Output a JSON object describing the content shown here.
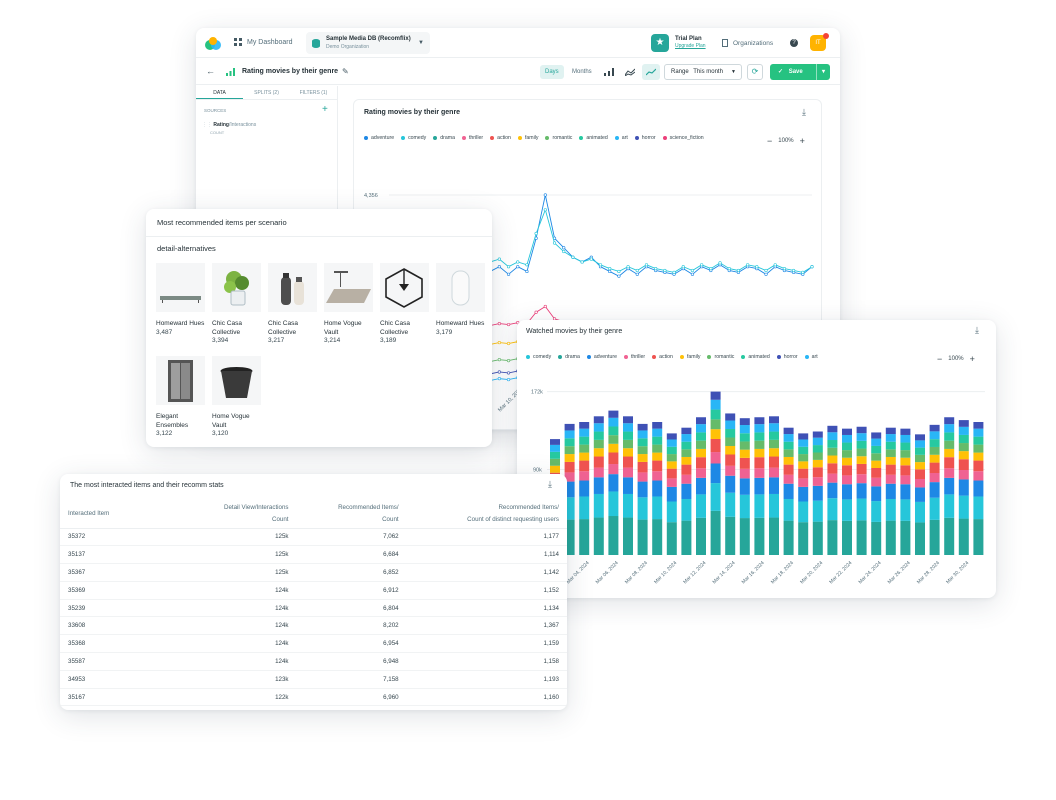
{
  "colors": {
    "adventure": "#1e88e5",
    "comedy": "#26c6da",
    "drama": "#26a69a",
    "thriller": "#f06292",
    "action": "#ef5350",
    "family": "#ffc107",
    "romantic": "#66bb6a",
    "animated": "#26c9a0",
    "art": "#29b6f6",
    "horror": "#3f51b5",
    "science_fiction": "#ec407a",
    "accent": "#26a69a"
  },
  "app": {
    "nav": {
      "dashboard": "My Dashboard"
    },
    "db": {
      "name": "Sample Media DB (Recomflix)",
      "org": "Demo Organization"
    },
    "plan": {
      "name": "Trial Plan",
      "upgrade": "Upgrade Plan"
    },
    "organizations": "Organizations",
    "help": "?",
    "avatar": "IT",
    "page_title": "Rating movies by their genre",
    "toggle": {
      "days": "Days",
      "months": "Months"
    },
    "range": {
      "label": "Range",
      "value": "This month"
    },
    "save": "Save",
    "side": {
      "tabs": [
        "DATA",
        "SPLITS (2)",
        "FILTERS (1)"
      ],
      "sources_label": "SOURCES",
      "source": {
        "name": "Rating",
        "sub": "/Interactions",
        "agg": "COUNT"
      }
    },
    "chart": {
      "title": "Rating movies by their genre",
      "legend": [
        "adventure",
        "comedy",
        "drama",
        "thriller",
        "action",
        "family",
        "romantic",
        "animated",
        "art",
        "horror",
        "science_fiction"
      ],
      "zoom": "100%",
      "ytick": "4,356",
      "xtick": "Mar 10, 2024"
    }
  },
  "recommended": {
    "title": "Most recommended items per scenario",
    "scenario": "detail-alternatives",
    "items": [
      {
        "name": "Homeward Hues",
        "count": "3,487",
        "icon": "shelf-image"
      },
      {
        "name": "Chic Casa Collective",
        "count": "3,394",
        "icon": "plant-image"
      },
      {
        "name": "Chic Casa Collective",
        "count": "3,217",
        "icon": "bottles-image"
      },
      {
        "name": "Home Vogue Vault",
        "count": "3,214",
        "icon": "rug-image"
      },
      {
        "name": "Chic Casa Collective",
        "count": "3,189",
        "icon": "cube-lamp-image"
      },
      {
        "name": "Homeward Hues",
        "count": "3,179",
        "icon": "vase-image"
      },
      {
        "name": "Elegant Ensembles",
        "count": "3,122",
        "icon": "cabinet-image"
      },
      {
        "name": "Home Vogue Vault",
        "count": "3,120",
        "icon": "pot-image"
      }
    ]
  },
  "watched": {
    "title": "Watched movies by their genre",
    "legend": [
      "comedy",
      "drama",
      "adventure",
      "thriller",
      "action",
      "family",
      "romantic",
      "animated",
      "horror",
      "art"
    ],
    "zoom": "100%"
  },
  "table": {
    "title": "The most interacted items and their recomm stats",
    "headers": [
      [
        "Interacted Item"
      ],
      [
        "Detail View/Interactions",
        "Count"
      ],
      [
        "Recommended Items/",
        "Count"
      ],
      [
        "Recommended Items/",
        "Count of distinct requesting users"
      ]
    ],
    "rows": [
      [
        "35372",
        "125k",
        "7,062",
        "1,177"
      ],
      [
        "35137",
        "125k",
        "6,684",
        "1,114"
      ],
      [
        "35367",
        "125k",
        "6,852",
        "1,142"
      ],
      [
        "35369",
        "124k",
        "6,912",
        "1,152"
      ],
      [
        "35239",
        "124k",
        "6,804",
        "1,134"
      ],
      [
        "33608",
        "124k",
        "8,202",
        "1,367"
      ],
      [
        "35368",
        "124k",
        "6,954",
        "1,159"
      ],
      [
        "35587",
        "124k",
        "6,948",
        "1,158"
      ],
      [
        "34953",
        "123k",
        "7,158",
        "1,193"
      ],
      [
        "35167",
        "122k",
        "6,960",
        "1,160"
      ]
    ]
  },
  "chart_data": [
    {
      "type": "line",
      "title": "Rating movies by their genre",
      "yticks": [
        "4,356"
      ],
      "xticks": [
        "Mar 10, 2024"
      ],
      "series": [
        {
          "name": "adventure",
          "values": [
            3350,
            3380,
            3400,
            3420,
            3500,
            3600,
            3750,
            3880,
            3700,
            3650,
            3600,
            3550,
            3600,
            3520,
            3600,
            3550,
            3900,
            4356,
            3900,
            3800,
            3700,
            3650,
            3700,
            3600,
            3550,
            3500,
            3580,
            3520,
            3600,
            3560,
            3540,
            3520,
            3580,
            3520,
            3600,
            3560,
            3620,
            3560,
            3540,
            3600,
            3580,
            3520,
            3600,
            3560,
            3540,
            3520,
            3600
          ]
        },
        {
          "name": "comedy",
          "values": [
            3400,
            3420,
            3440,
            3500,
            3560,
            3650,
            3800,
            3900,
            3820,
            3750,
            3700,
            3650,
            3680,
            3600,
            3650,
            3620,
            3950,
            4200,
            3850,
            3760,
            3700,
            3650,
            3680,
            3620,
            3580,
            3550,
            3600,
            3560,
            3620,
            3580,
            3560,
            3540,
            3600,
            3560,
            3620,
            3580,
            3640,
            3580,
            3560,
            3620,
            3600,
            3560,
            3620,
            3580,
            3560,
            3540,
            3600
          ]
        },
        {
          "name": "science_fiction",
          "values": [
            2950,
            2960,
            2940,
            2970,
            3000,
            3020,
            3050,
            3100,
            3010,
            2990,
            3000,
            2980,
            3000,
            2990,
            3010,
            3000,
            3120,
            3180,
            3050,
            3020,
            3000,
            2990,
            3010,
            3000,
            2980,
            2970,
            3000,
            2980,
            3010,
            2990,
            2980,
            2970,
            3000,
            2990,
            3010,
            2990,
            3020,
            3000,
            2990,
            3010,
            3000,
            2990,
            3010,
            2990,
            2980,
            2970,
            3000
          ]
        },
        {
          "name": "family",
          "values": [
            2750,
            2760,
            2740,
            2770,
            2800,
            2820,
            2850,
            2880,
            2810,
            2790,
            2800,
            2780,
            2800,
            2790,
            2810,
            2800,
            2900,
            2940,
            2840,
            2810,
            2790,
            2780,
            2800,
            2790,
            2770,
            2760,
            2790,
            2770,
            2800,
            2780,
            2770,
            2760,
            2790,
            2780,
            2800,
            2780,
            2810,
            2790,
            2780,
            2800,
            2790,
            2780,
            2800,
            2780,
            2770,
            2760,
            2790
          ]
        },
        {
          "name": "romantic",
          "values": [
            2580,
            2590,
            2570,
            2600,
            2620,
            2640,
            2660,
            2680,
            2630,
            2610,
            2620,
            2600,
            2620,
            2610,
            2630,
            2620,
            2700,
            2730,
            2650,
            2630,
            2610,
            2600,
            2620,
            2610,
            2590,
            2580,
            2610,
            2590,
            2620,
            2600,
            2590,
            2580,
            2610,
            2600,
            2620,
            2600,
            2630,
            2610,
            2600,
            2620,
            2610,
            2600,
            2620,
            2600,
            2590,
            2580,
            2610
          ]
        },
        {
          "name": "horror",
          "values": [
            2450,
            2460,
            2440,
            2470,
            2490,
            2500,
            2520,
            2540,
            2500,
            2480,
            2490,
            2470,
            2490,
            2480,
            2500,
            2490,
            2560,
            2590,
            2510,
            2490,
            2480,
            2470,
            2490,
            2480,
            2460,
            2450,
            2480,
            2460,
            2490,
            2470,
            2460,
            2450,
            2480,
            2470,
            2490,
            2470,
            2500,
            2480,
            2470,
            2490,
            2480,
            2470,
            2490,
            2470,
            2460,
            2450,
            2480
          ]
        },
        {
          "name": "art",
          "values": [
            2380,
            2390,
            2370,
            2400,
            2420,
            2430,
            2450,
            2470,
            2430,
            2410,
            2420,
            2400,
            2420,
            2410,
            2430,
            2420,
            2480,
            2510,
            2440,
            2420,
            2410,
            2400,
            2420,
            2410,
            2390,
            2380,
            2410,
            2390,
            2420,
            2400,
            2390,
            2380,
            2410,
            2400,
            2420,
            2400,
            2430,
            2410,
            2400,
            2420,
            2410,
            2400,
            2420,
            2400,
            2390,
            2380,
            2410
          ]
        }
      ]
    },
    {
      "type": "bar",
      "title": "Watched movies by their genre",
      "yticks": [
        "172k",
        "90k"
      ],
      "categories": [
        "Mar 02, 2024",
        "Mar 03, 2024",
        "Mar 04, 2024",
        "Mar 05, 2024",
        "Mar 06, 2024",
        "Mar 07, 2024",
        "Mar 08, 2024",
        "Mar 09, 2024",
        "Mar 10, 2024",
        "Mar 11, 2024",
        "Mar 12, 2024",
        "Mar 13, 2024",
        "Mar 14, 2024",
        "Mar 15, 2024",
        "Mar 16, 2024",
        "Mar 17, 2024",
        "Mar 18, 2024",
        "Mar 19, 2024",
        "Mar 20, 2024",
        "Mar 21, 2024",
        "Mar 22, 2024",
        "Mar 23, 2024",
        "Mar 24, 2024",
        "Mar 25, 2024",
        "Mar 26, 2024",
        "Mar 27, 2024",
        "Mar 28, 2024",
        "Mar 29, 2024",
        "Mar 30, 2024",
        "Mar 31, 2024"
      ],
      "xticks": [
        "Mar 02, 2024",
        "Mar 04, 2024",
        "Mar 06, 2024",
        "Mar 08, 2024",
        "Mar 10, 2024",
        "Mar 12, 2024",
        "Mar 14, 2024",
        "Mar 16, 2024",
        "Mar 18, 2024",
        "Mar 20, 2024",
        "Mar 22, 2024",
        "Mar 24, 2024",
        "Mar 26, 2024",
        "Mar 28, 2024",
        "Mar 30, 2024"
      ],
      "totals": [
        122,
        138,
        140,
        146,
        152,
        146,
        138,
        140,
        128,
        134,
        145,
        172,
        149,
        144,
        145,
        146,
        134,
        128,
        130,
        136,
        133,
        135,
        129,
        134,
        133,
        127,
        137,
        145,
        142,
        140
      ],
      "stack_order": [
        "drama",
        "comedy",
        "adventure",
        "thriller",
        "action",
        "family",
        "romantic",
        "animated",
        "art",
        "horror"
      ],
      "shares": [
        0.27,
        0.17,
        0.12,
        0.07,
        0.08,
        0.06,
        0.06,
        0.06,
        0.06,
        0.05
      ],
      "ylim": [
        0,
        180
      ]
    }
  ]
}
